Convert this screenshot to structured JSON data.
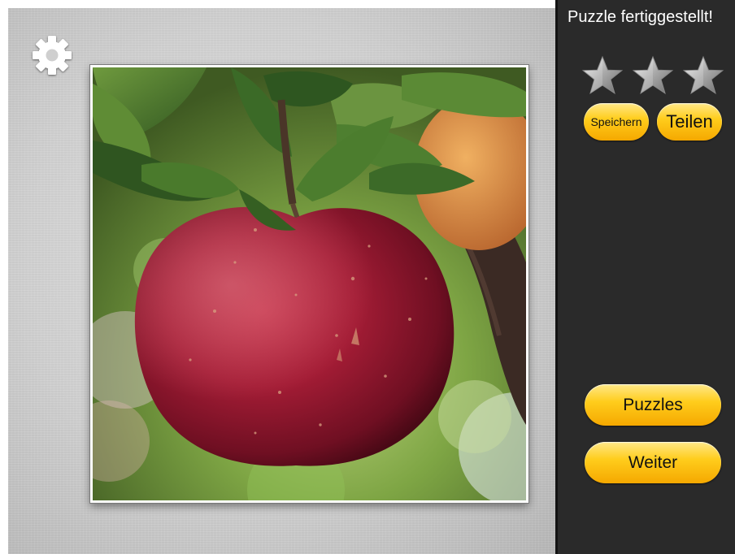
{
  "status": {
    "title": "Puzzle fertiggestellt!"
  },
  "rating": {
    "stars_earned": 3,
    "stars_total": 3,
    "star_color": "#b8b8b8"
  },
  "actions": {
    "save_label": "Speichern",
    "share_label": "Teilen",
    "puzzles_label": "Puzzles",
    "next_label": "Weiter"
  },
  "settings": {
    "icon": "gear-icon"
  },
  "puzzle": {
    "subject": "red apple on branch",
    "completed": true
  },
  "colors": {
    "panel_bg": "#2a2a2a",
    "button_yellow": "#ffcd1c",
    "board_bg": "#d2d2d2"
  }
}
